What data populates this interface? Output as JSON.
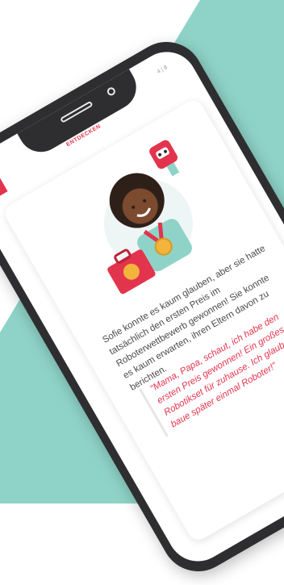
{
  "header": {
    "title": "ENTDECKEN",
    "page_counter": "4 | 8"
  },
  "nav": {
    "back_icon": "chevron-left-icon",
    "back_glyph": "‹"
  },
  "story": {
    "paragraph": "Sofie konnte es kaum glauben, aber sie hatte tatsächlich den ersten Preis im Roboterwettbewerb gewonnen! Sie konnte es kaum erwarten, ihren Eltern davon zu berichten.",
    "quote": "\"Mama, Papa, schaut, ich habe den ersten Preis gewonnen! Ein großes Robotikset für zuhause. Ich glaube, ich baue später einmal Roboter!\""
  },
  "colors": {
    "accent": "#e3344d",
    "teal": "#8fd3c8",
    "phone": "#2e2e30"
  }
}
